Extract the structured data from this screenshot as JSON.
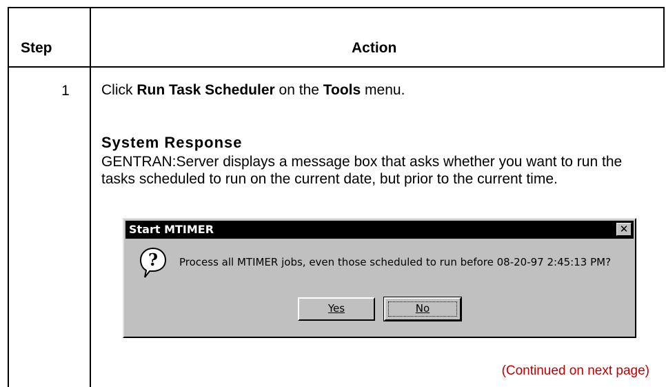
{
  "table": {
    "header_step": "Step",
    "header_action": "Action"
  },
  "row": {
    "step_number": "1",
    "instruction_pre": "Click ",
    "instruction_cmd": "Run Task Scheduler",
    "instruction_mid": " on the ",
    "instruction_menu": "Tools",
    "instruction_post": " menu.",
    "system_response_title": "System Response",
    "system_response_text": "GENTRAN:Server displays a message box that asks whether you want to run the tasks scheduled to run on the current date, but prior to the current time."
  },
  "dialog": {
    "title": "Start MTIMER",
    "close_glyph": "✕",
    "message": "Process all MTIMER jobs, even those scheduled to run before 08-20-97  2:45:13 PM?",
    "yes_label": "Yes",
    "no_label": "No",
    "icon": "question-icon"
  },
  "footer": {
    "continued": "(Continued on next page)"
  },
  "colors": {
    "continued_text": "#c00000",
    "dialog_face": "#c0c0c0",
    "titlebar": "#000000"
  }
}
